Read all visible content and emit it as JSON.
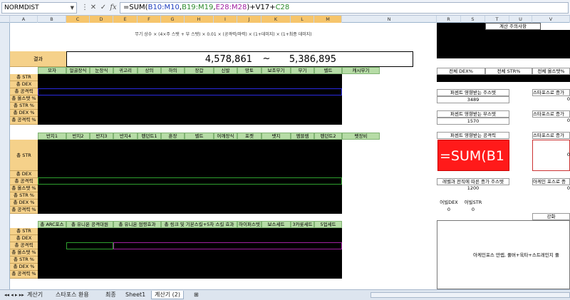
{
  "name_box": "NORMDIST",
  "formula": {
    "prefix": "=SUM(",
    "r1": "B10:M10",
    "r2": "B19:M19",
    "r3": "E28:M28",
    "close": ")+V17+",
    "r4": "C28"
  },
  "columns": [
    "A",
    "B",
    "C",
    "D",
    "E",
    "F",
    "G",
    "H",
    "I",
    "J",
    "K",
    "L",
    "M",
    "N",
    "R",
    "S",
    "T",
    "U",
    "V"
  ],
  "description": "무기 상수 × (4×주 스탯 + 부 스탯) × 0.01 × (공격력/마력) × (1+데미지) × (1+최종 데미지)",
  "result": {
    "label": "결과",
    "min": "4,578,861",
    "tilde": "~",
    "max": "5,386,895"
  },
  "section1": {
    "headers": [
      "모자",
      "얼굴장식",
      "눈장식",
      "귀고리",
      "상의",
      "하의",
      "장갑",
      "신발",
      "망토",
      "보조무기",
      "무기",
      "벨트",
      "캐시무기"
    ],
    "rows": [
      "총 STR",
      "총 DEX",
      "총 공격력",
      "총 올스탯 %",
      "총 STR %",
      "총 DEX %",
      "총 공격력 %"
    ]
  },
  "section2": {
    "headers": [
      "반지1",
      "반지2",
      "반지3",
      "반지4",
      "펜던트1",
      "훈장",
      "벨트",
      "어깨장식",
      "포켓",
      "뱃지",
      "엠블렘",
      "펜던트2",
      "펫장비"
    ],
    "rows": [
      "총 STR",
      "총 DEX",
      "총 공격력",
      "총 올스탯 %",
      "총 STR %",
      "총 DEX %",
      "총 공격력 %"
    ]
  },
  "section3": {
    "headers": [
      "총 ARC포스",
      "총 유니온 공격대원",
      "총 유니온 점령효과",
      "총 링크 및 기본스킬+5차 스킬 효과",
      "하이퍼스텟",
      "보스세트",
      "3카룻세트",
      "5업세트"
    ],
    "rows": [
      "총 STR",
      "총 DEX",
      "총 공격력",
      "총 올스탯 %",
      "총 STR %",
      "총 DEX %",
      "총 공격력 %"
    ]
  },
  "right": {
    "notes_title": "계산 주의사항",
    "pct_headers": [
      "전체 DEX%",
      "전체 STR%",
      "전체 올스탯%"
    ],
    "main_stat_label": "퍼센트 영향받는 주스텟",
    "main_stat_value": "3489",
    "starforce_label1": "스타포스로 증가",
    "starforce_value1": "0",
    "sub_stat_label": "퍼센트 영향받는 부스텟",
    "sub_stat_value": "1570",
    "starforce_label2": "스타포스로 증가",
    "starforce_value2": "0",
    "atk_label": "퍼센트 영향받는 공격력",
    "editing_formula": "=SUM(B1",
    "starforce_label3": "스타포스로 증가",
    "starforce_value3": "0",
    "level_label": "레벨과 전직에 따른 증가 주스텟",
    "level_value": "1200",
    "arcane_label": "아케인 포스로 증",
    "arcane_value": "0",
    "arcane_dex_label": "어빌DEX",
    "arcane_dex_value": "0",
    "arcane_str_label": "어빌STR",
    "arcane_str_value": "0",
    "enhance_label": "강화",
    "bottom_note": "아케인포스 만렙, 풀버+육타+스트레인지 풀"
  },
  "tabs": [
    "계산기",
    "스타포스 환용",
    "최종",
    "Sheet1",
    "계산기 (2)"
  ],
  "active_tab": "계산기 (2)"
}
